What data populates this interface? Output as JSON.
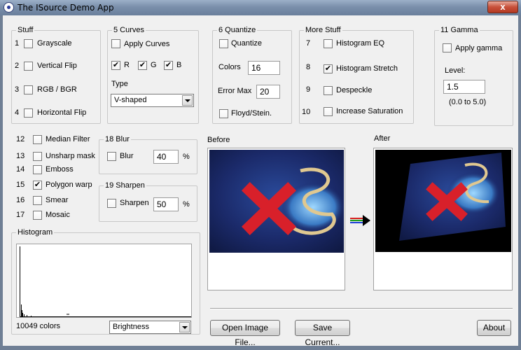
{
  "window": {
    "title": "The ISource Demo App",
    "close_label": "x"
  },
  "stuff": {
    "legend": "Stuff",
    "items": [
      {
        "num": "1",
        "label": "Grayscale",
        "checked": false
      },
      {
        "num": "2",
        "label": "Vertical Flip",
        "checked": false
      },
      {
        "num": "3",
        "label": "RGB / BGR",
        "checked": false
      },
      {
        "num": "4",
        "label": "Horizontal Flip",
        "checked": false
      }
    ]
  },
  "curves": {
    "legend": "5  Curves",
    "apply_label": "Apply Curves",
    "r_label": "R",
    "g_label": "G",
    "b_label": "B",
    "type_label": "Type",
    "type_value": "V-shaped"
  },
  "quantize": {
    "legend": "6  Quantize",
    "quantize_label": "Quantize",
    "colors_label": "Colors",
    "colors_value": "16",
    "error_label": "Error Max",
    "error_value": "20",
    "floyd_label": "Floyd/Stein."
  },
  "more": {
    "legend": "More Stuff",
    "items": [
      {
        "num": "7",
        "label": "Histogram EQ",
        "checked": false
      },
      {
        "num": "8",
        "label": "Histogram Stretch",
        "checked": true
      },
      {
        "num": "9",
        "label": "Despeckle",
        "checked": false
      },
      {
        "num": "10",
        "label": "Increase Saturation",
        "checked": false
      }
    ]
  },
  "gamma": {
    "legend": "11  Gamma",
    "apply_label": "Apply gamma",
    "level_label": "Level:",
    "level_value": "1.5",
    "range_label": "(0.0 to 5.0)"
  },
  "filters": {
    "items": [
      {
        "num": "12",
        "label": "Median Filter",
        "checked": false
      },
      {
        "num": "13",
        "label": "Unsharp mask",
        "checked": false
      },
      {
        "num": "14",
        "label": "Emboss",
        "checked": false
      },
      {
        "num": "15",
        "label": "Polygon warp",
        "checked": true
      },
      {
        "num": "16",
        "label": "Smear",
        "checked": false
      },
      {
        "num": "17",
        "label": "Mosaic",
        "checked": false
      }
    ]
  },
  "blur": {
    "legend": "18  Blur",
    "label": "Blur",
    "value": "40",
    "unit": "%"
  },
  "sharpen": {
    "legend": "19  Sharpen",
    "label": "Sharpen",
    "value": "50",
    "unit": "%"
  },
  "histogram": {
    "legend": "Histogram",
    "colors_count": "10049 colors",
    "channel_value": "Brightness"
  },
  "before": {
    "label": "Before"
  },
  "after": {
    "label": "After"
  },
  "buttons": {
    "open": "Open Image File...",
    "save": "Save Current...",
    "about": "About"
  },
  "check_mark": "✔",
  "colors": {
    "titlebar": "#7a8fab",
    "close": "#c7503a",
    "image_bg": "#1b2a63",
    "red_x": "#d8202a"
  }
}
